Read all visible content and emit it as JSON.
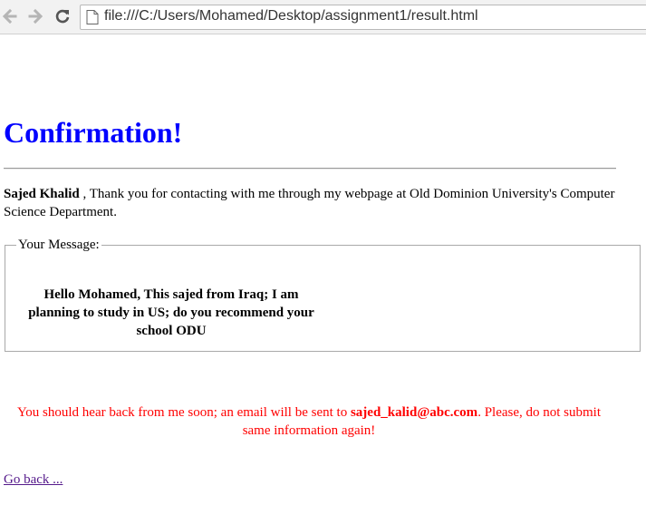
{
  "browser": {
    "url": "file:///C:/Users/Mohamed/Desktop/assignment1/result.html"
  },
  "page": {
    "title": "Confirmation!",
    "thanks": {
      "name": "Sajed Khalid",
      "text": " , Thank you for contacting with me through my webpage at Old Dominion University's Computer Science Department."
    },
    "message": {
      "legend": "Your Message:",
      "body": "Hello Mohamed, This sajed from Iraq; I am planning to study in US; do you recommend your school ODU"
    },
    "notice": {
      "prefix": "You should hear back from me soon; an email will be sent to ",
      "email": "sajed_kalid@abc.com",
      "suffix": ". Please, do not submit same information again!"
    },
    "go_back_label": "Go back ... "
  },
  "colors": {
    "title": "#0000ff",
    "notice": "#ff0000",
    "link": "#551a8b"
  }
}
